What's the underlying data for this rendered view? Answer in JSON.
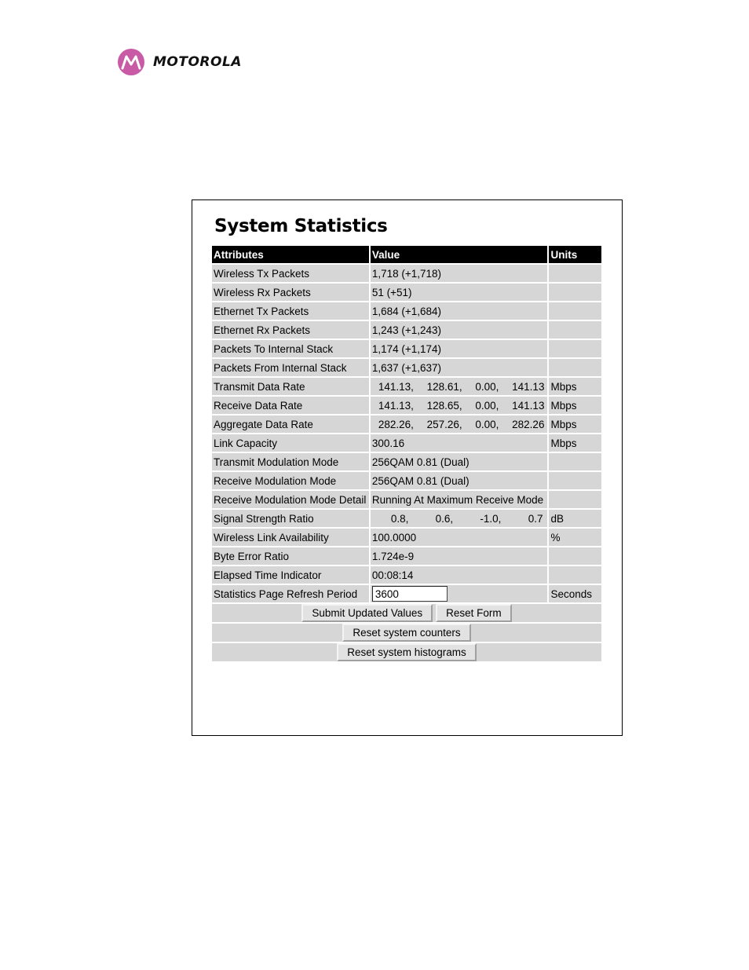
{
  "brand": {
    "name": "MOTOROLA"
  },
  "page": {
    "title": "System Statistics"
  },
  "table": {
    "headers": {
      "attributes": "Attributes",
      "value": "Value",
      "units": "Units"
    },
    "rows": [
      {
        "attr": "Wireless Tx Packets",
        "value": "1,718 (+1,718)",
        "unit": ""
      },
      {
        "attr": "Wireless Rx Packets",
        "value": "51 (+51)",
        "unit": ""
      },
      {
        "attr": "Ethernet Tx Packets",
        "value": "1,684 (+1,684)",
        "unit": ""
      },
      {
        "attr": "Ethernet Rx Packets",
        "value": "1,243 (+1,243)",
        "unit": ""
      },
      {
        "attr": "Packets To Internal Stack",
        "value": "1,174 (+1,174)",
        "unit": ""
      },
      {
        "attr": "Packets From Internal Stack",
        "value": "1,637 (+1,637)",
        "unit": ""
      },
      {
        "attr": "Transmit Data Rate",
        "values": [
          "141.13,",
          "128.61,",
          "0.00,",
          "141.13"
        ],
        "unit": "Mbps"
      },
      {
        "attr": "Receive Data Rate",
        "values": [
          "141.13,",
          "128.65,",
          "0.00,",
          "141.13"
        ],
        "unit": "Mbps"
      },
      {
        "attr": "Aggregate Data Rate",
        "values": [
          "282.26,",
          "257.26,",
          "0.00,",
          "282.26"
        ],
        "unit": "Mbps"
      },
      {
        "attr": "Link Capacity",
        "value": "300.16",
        "unit": "Mbps"
      },
      {
        "attr": "Transmit Modulation Mode",
        "value": "256QAM 0.81 (Dual)",
        "unit": ""
      },
      {
        "attr": "Receive Modulation Mode",
        "value": "256QAM 0.81 (Dual)",
        "unit": ""
      },
      {
        "attr": "Receive Modulation Mode Detail",
        "value": "Running At Maximum Receive Mode",
        "unit": ""
      },
      {
        "attr": "Signal Strength Ratio",
        "values": [
          "0.8,",
          "0.6,",
          "-1.0,",
          "0.7"
        ],
        "unit": "dB"
      },
      {
        "attr": "Wireless Link Availability",
        "value": "100.0000",
        "unit": "%"
      },
      {
        "attr": "Byte Error Ratio",
        "value": "1.724e-9",
        "unit": ""
      },
      {
        "attr": "Elapsed Time Indicator",
        "value": "00:08:14",
        "unit": ""
      }
    ],
    "refresh": {
      "label": "Statistics Page Refresh Period",
      "value": "3600",
      "unit": "Seconds"
    }
  },
  "buttons": {
    "submit": "Submit Updated Values",
    "reset_form": "Reset Form",
    "reset_counters": "Reset system counters",
    "reset_histograms": "Reset system histograms"
  },
  "colors": {
    "brand_magenta": "#c85aa6",
    "header_bg": "#000000",
    "cell_bg": "#d6d6d6"
  }
}
